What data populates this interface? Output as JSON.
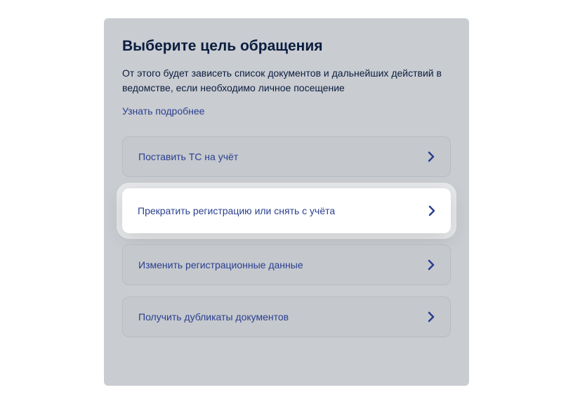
{
  "title": "Выберите цель обращения",
  "subtitle": "От этого будет зависеть список документов и дальнейших действий в ведомстве, если необходимо личное посещение",
  "learn_more": "Узнать подробнее",
  "options": [
    {
      "label": "Поставить ТС на учёт"
    },
    {
      "label": "Прекратить регистрацию или снять с учёта"
    },
    {
      "label": "Изменить регистрационные данные"
    },
    {
      "label": "Получить дубликаты документов"
    }
  ]
}
